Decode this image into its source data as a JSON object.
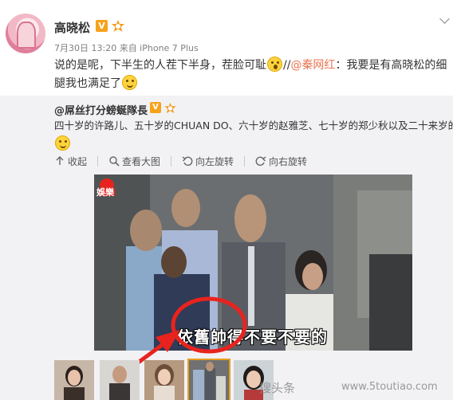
{
  "post": {
    "username": "高晓松",
    "verified_badge": "V",
    "level_badge_icon": "orange-lv-icon",
    "expand_icon": "chevron-down-icon",
    "time": "7月30日 13:20 来自 iPhone 7 Plus",
    "text_part1": "说的是呢，下半生的人茬下半身，茬脸可耻",
    "mention_prefix": "//",
    "mention": "@秦网红",
    "text_part2": "：我要是有高晓松的细腿我也满足了"
  },
  "repost": {
    "username": "@屌丝打分螃蜒隊長",
    "verified_badge": "V",
    "text": "四十岁的许路儿、五十岁的CHUAN DO、六十岁的赵雅芝、七十岁的郑少秋以及二十来岁的你",
    "toolbar": {
      "collapse": "收起",
      "view_large": "查看大图",
      "rotate_left": "向左旋转",
      "rotate_right": "向右旋转"
    },
    "photo": {
      "logo": "娛樂",
      "caption": "依舊帥得不要不要的"
    },
    "thumbnails": 6,
    "selected_thumbnail": 4
  },
  "watermark": {
    "text": "搜头条",
    "url": "www.5toutiao.com"
  },
  "colors": {
    "link": "#eb7350",
    "badge": "#f7a21b",
    "repost_bg": "#f2f2f5",
    "annotation_red": "#e8231e",
    "selected_thumb": "#e79e1d"
  }
}
